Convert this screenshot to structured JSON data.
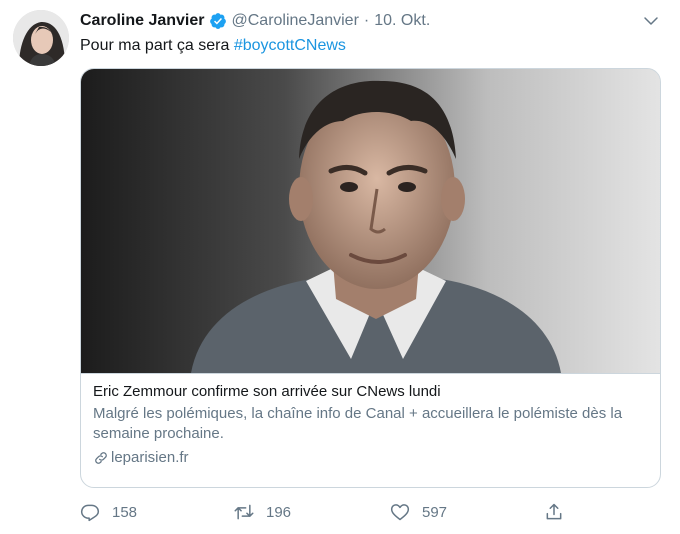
{
  "tweet": {
    "author": {
      "name": "Caroline Janvier",
      "handle": "@CarolineJanvier",
      "verified": true
    },
    "separator": "·",
    "date": "10. Okt.",
    "text_prefix": "Pour ma part ça sera ",
    "hashtag": "#boycottCNews",
    "card": {
      "title": "Eric Zemmour confirme son arrivée sur CNews lundi",
      "description": "Malgré les polémiques, la chaîne info de Canal + accueillera le polémiste dès la semaine prochaine.",
      "domain": "leparisien.fr"
    },
    "actions": {
      "replies": "158",
      "retweets": "196",
      "likes": "597"
    }
  },
  "colors": {
    "link": "#1b95e0",
    "verified": "#1da1f2",
    "muted": "#657786",
    "border": "#ccd6dd"
  },
  "icons": [
    "verified-badge-icon",
    "chevron-down-icon",
    "link-icon",
    "reply-icon",
    "retweet-icon",
    "like-icon",
    "share-icon"
  ]
}
